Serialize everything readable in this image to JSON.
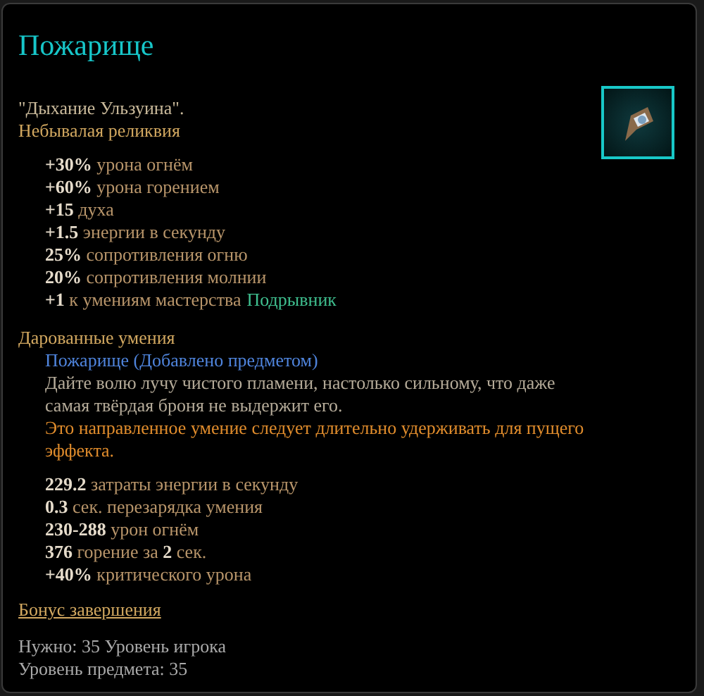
{
  "title": "Пожарище",
  "flavor": "\"Дыхание Ульзуина\".",
  "rarity": "Небывалая реликвия",
  "stats": [
    {
      "text": "**+30%** урона огнём"
    },
    {
      "text": "**+60%** урона горением"
    },
    {
      "text": "**+15** духа"
    },
    {
      "text": "**+1.5** энергии в секунду"
    },
    {
      "text": "**25%** сопротивления огню"
    },
    {
      "text": "**20%** сопротивления молнии"
    },
    {
      "text": "**+1** к умениям мастерства",
      "mastery": "Подрывник"
    }
  ],
  "granted": {
    "header": "Дарованные умения",
    "skill": "Пожарище (Добавлено предметом)",
    "description": "Дайте волю лучу чистого пламени, настолько сильному, что даже самая твёрдая броня не выдержит его.",
    "note": "Это направленное умение следует длительно удерживать для пущего эффекта.",
    "stats": [
      {
        "text": "**229.2** затраты энергии в секунду"
      },
      {
        "text": "**0.3** сек. перезарядка умения"
      },
      {
        "text": "**230-288** урон огнём"
      },
      {
        "text": "**376** горение за **2** сек."
      },
      {
        "text": "**+40%** критического урона"
      }
    ]
  },
  "completion_bonus": "Бонус завершения",
  "requirements": [
    "Нужно: 35 Уровень игрока",
    "Уровень предмета: 35"
  ]
}
